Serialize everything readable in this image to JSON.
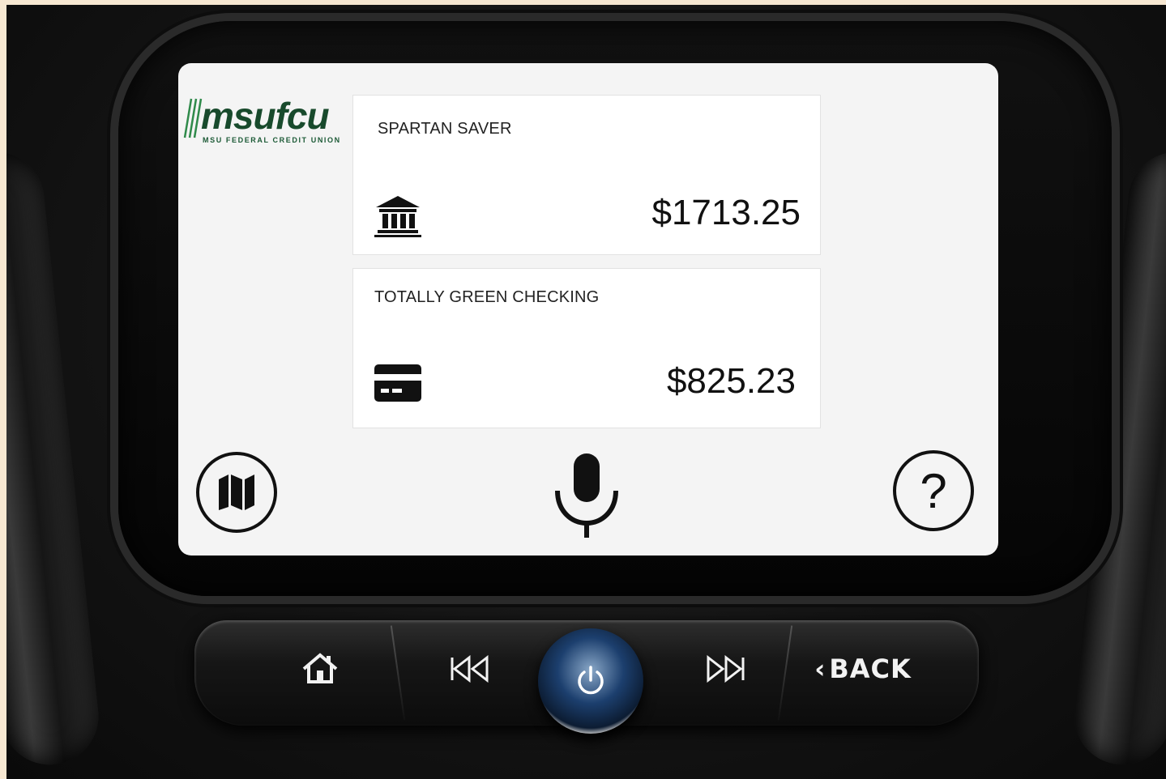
{
  "app": {
    "logo_text": "msufcu",
    "logo_subtitle": "MSU FEDERAL CREDIT UNION",
    "brand_color": "#184a2c"
  },
  "accounts": [
    {
      "name": "SPARTAN SAVER",
      "icon": "bank-icon",
      "balance": "$1713.25"
    },
    {
      "name": "TOTALLY GREEN CHECKING",
      "icon": "credit-card-icon",
      "balance": "$825.23"
    }
  ],
  "bottom_bar": {
    "left_icon": "map-icon",
    "center_icon": "microphone-icon",
    "right_label": "?"
  },
  "hardware_controls": {
    "home_icon": "home-icon",
    "prev_icon": "previous-track-icon",
    "power_icon": "power-icon",
    "next_icon": "next-track-icon",
    "back_label": "BACK"
  }
}
